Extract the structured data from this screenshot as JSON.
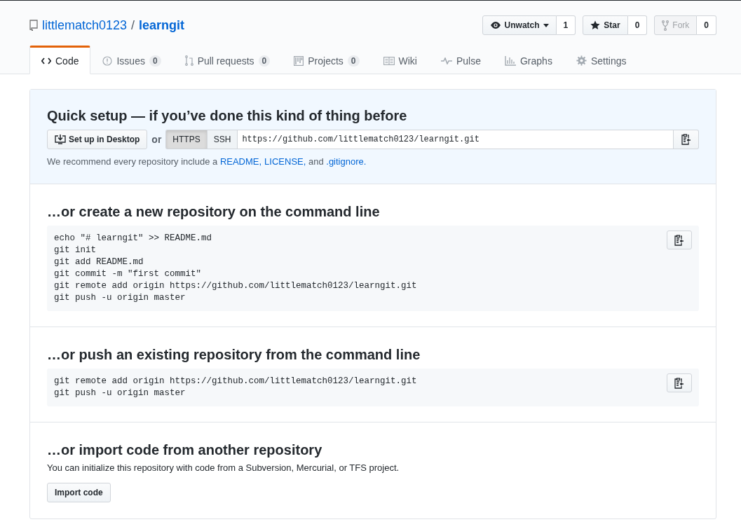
{
  "repo": {
    "owner": "littlematch0123",
    "separator": "/",
    "name": "learngit"
  },
  "actions": [
    {
      "label": "Unwatch",
      "count": "1",
      "disabled": false,
      "dropdown": true
    },
    {
      "label": "Star",
      "count": "0",
      "disabled": false,
      "dropdown": false
    },
    {
      "label": "Fork",
      "count": "0",
      "disabled": true,
      "dropdown": false
    }
  ],
  "tabs": [
    {
      "label": "Code",
      "selected": true
    },
    {
      "label": "Issues",
      "count": "0",
      "selected": false
    },
    {
      "label": "Pull requests",
      "count": "0",
      "selected": false
    },
    {
      "label": "Projects",
      "count": "0",
      "selected": false
    },
    {
      "label": "Wiki",
      "selected": false
    },
    {
      "label": "Pulse",
      "selected": false
    },
    {
      "label": "Graphs",
      "selected": false
    },
    {
      "label": "Settings",
      "selected": false
    }
  ],
  "quick_setup": {
    "title": "Quick setup — if you’ve done this kind of thing before",
    "desktop_button": "Set up in Desktop",
    "or": "or",
    "protocols": [
      {
        "label": "HTTPS",
        "selected": true
      },
      {
        "label": "SSH",
        "selected": false
      }
    ],
    "url": "https://github.com/littlematch0123/learngit.git",
    "recommendation": [
      {
        "kind": "text",
        "text": "We recommend every repository include a "
      },
      {
        "kind": "link",
        "text": "README,"
      },
      {
        "kind": "link",
        "text": "LICENSE,"
      },
      {
        "kind": "text",
        "text": " and "
      },
      {
        "kind": "link",
        "text": ".gitignore."
      }
    ]
  },
  "sections": [
    {
      "title": "…or create a new repository on the command line",
      "code": [
        "echo \"# learngit\" >> README.md",
        "git init",
        "git add README.md",
        "git commit -m \"first commit\"",
        "git remote add origin https://github.com/littlematch0123/learngit.git",
        "git push -u origin master"
      ]
    },
    {
      "title": "…or push an existing repository from the command line",
      "code": [
        "git remote add origin https://github.com/littlematch0123/learngit.git",
        "git push -u origin master"
      ]
    }
  ],
  "import": {
    "title": "…or import code from another repository",
    "text": "You can initialize this repository with code from a Subversion, Mercurial, or TFS project.",
    "button": "Import code"
  }
}
